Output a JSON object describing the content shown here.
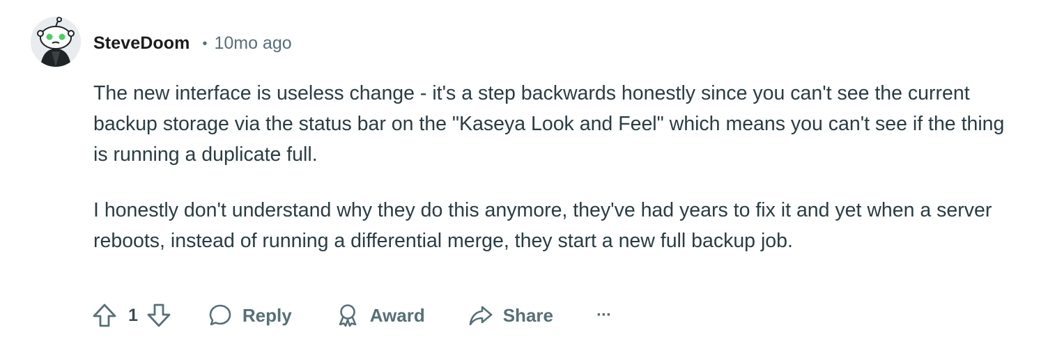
{
  "comment": {
    "author": "SteveDoom",
    "separator": "•",
    "time_ago": "10mo ago",
    "paragraphs": [
      "The new interface is useless change - it's a step backwards honestly since you can't see the current backup storage via the status bar on the \"Kaseya Look and Feel\" which means you can't see if the thing is running a duplicate full.",
      "I honestly don't understand why they do this anymore, they've had years to fix it and yet when a server reboots, instead of running a differential merge, they start a new full backup job."
    ]
  },
  "actions": {
    "score": "1",
    "reply_label": "Reply",
    "award_label": "Award",
    "share_label": "Share",
    "more_label": "···"
  },
  "icons": {
    "upvote": "arrow-up-outline-icon",
    "downvote": "arrow-down-outline-icon",
    "reply": "speech-bubble-icon",
    "award": "award-ribbon-icon",
    "share": "share-arrow-icon",
    "more": "ellipsis-icon"
  },
  "colors": {
    "text_primary": "#1c1c1c",
    "text_body": "#2a3c42",
    "text_secondary": "#576f76",
    "avatar_accent": "#46d160",
    "background": "#ffffff"
  }
}
